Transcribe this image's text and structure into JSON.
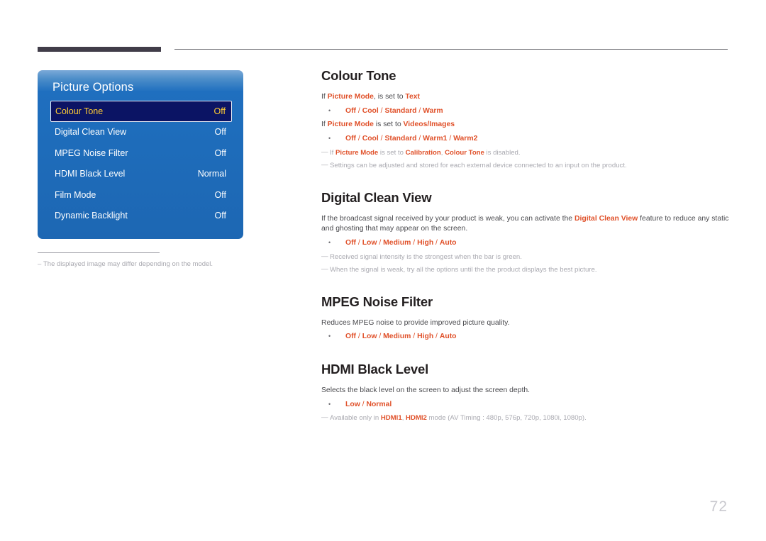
{
  "page": {
    "number": "72"
  },
  "osd": {
    "title": "Picture Options",
    "rows": [
      {
        "label": "Colour Tone",
        "value": "Off",
        "selected": true
      },
      {
        "label": "Digital Clean View",
        "value": "Off",
        "selected": false
      },
      {
        "label": "MPEG Noise Filter",
        "value": "Off",
        "selected": false
      },
      {
        "label": "HDMI Black Level",
        "value": "Normal",
        "selected": false
      },
      {
        "label": "Film Mode",
        "value": "Off",
        "selected": false
      },
      {
        "label": "Dynamic Backlight",
        "value": "Off",
        "selected": false
      }
    ],
    "figure_note": "The displayed image may differ depending on the model.",
    "figure_note_dash": "–",
    "colors": {
      "panel_top": "#7ba9d8",
      "panel_bottom": "#1d67b3",
      "selected_background": "#0b1464",
      "selected_text": "#ffcc33",
      "row_text": "#ffffff"
    }
  },
  "theme": {
    "accent": "#e0512a",
    "heading": "#231f20",
    "body": "#4b4b4f",
    "note": "#a9a9b0",
    "rule_thick": "#413d49",
    "rule_thin": "#6e6e73",
    "page_number": "#c9c9cf"
  },
  "sections": [
    {
      "id": "colour-tone",
      "title": "Colour Tone",
      "lines": [
        {
          "parts": [
            {
              "t": "If ",
              "a": false
            },
            {
              "t": "Picture Mode",
              "a": true
            },
            {
              "t": ", is set to ",
              "a": false
            },
            {
              "t": "Text",
              "a": true
            }
          ]
        }
      ],
      "options_1": {
        "bullet": "•",
        "items": [
          "Off",
          "Cool",
          "Standard",
          "Warm"
        ],
        "separator": "/"
      },
      "lines_2": [
        {
          "parts": [
            {
              "t": "If ",
              "a": false
            },
            {
              "t": "Picture Mode",
              "a": true
            },
            {
              "t": " is set to ",
              "a": false
            },
            {
              "t": "Videos/Images",
              "a": true
            }
          ]
        }
      ],
      "options_2": {
        "bullet": "•",
        "items": [
          "Off",
          "Cool",
          "Standard",
          "Warm1",
          "Warm2"
        ],
        "separator": "/"
      },
      "notes": [
        {
          "dash": "—",
          "parts": [
            {
              "t": "If ",
              "a": false
            },
            {
              "t": "Picture Mode",
              "a": true
            },
            {
              "t": " is set to ",
              "a": false
            },
            {
              "t": "Calibration",
              "a": true
            },
            {
              "t": ", ",
              "a": false
            },
            {
              "t": "Colour Tone",
              "a": true
            },
            {
              "t": " is disabled.",
              "a": false
            }
          ]
        },
        {
          "dash": "—",
          "parts": [
            {
              "t": "Settings can be adjusted and stored for each external device connected to an input on the product.",
              "a": false
            }
          ]
        }
      ]
    },
    {
      "id": "digital-clean-view",
      "title": "Digital Clean View",
      "lines": [
        {
          "parts": [
            {
              "t": "If the broadcast signal received by your product is weak, you can activate the ",
              "a": false
            },
            {
              "t": "Digital Clean View",
              "a": true
            },
            {
              "t": " feature to reduce any static and ghosting that may appear on the screen.",
              "a": false
            }
          ]
        }
      ],
      "options_1": {
        "bullet": "•",
        "items": [
          "Off",
          "Low",
          "Medium",
          "High",
          "Auto"
        ],
        "separator": "/"
      },
      "notes": [
        {
          "dash": "—",
          "parts": [
            {
              "t": "Received signal intensity is the strongest when the bar is green.",
              "a": false
            }
          ]
        },
        {
          "dash": "—",
          "parts": [
            {
              "t": "When the signal is weak, try all the options until the the product displays the best picture.",
              "a": false
            }
          ]
        }
      ]
    },
    {
      "id": "mpeg-noise-filter",
      "title": "MPEG Noise Filter",
      "lines": [
        {
          "parts": [
            {
              "t": "Reduces MPEG noise to provide improved picture quality.",
              "a": false
            }
          ]
        }
      ],
      "options_1": {
        "bullet": "•",
        "items": [
          "Off",
          "Low",
          "Medium",
          "High",
          "Auto"
        ],
        "separator": "/"
      },
      "notes": []
    },
    {
      "id": "hdmi-black-level",
      "title": "HDMI Black Level",
      "lines": [
        {
          "parts": [
            {
              "t": "Selects the black level on the screen to adjust the screen depth.",
              "a": false
            }
          ]
        }
      ],
      "options_1": {
        "bullet": "•",
        "items": [
          "Low",
          "Normal"
        ],
        "separator": "/"
      },
      "notes": [
        {
          "dash": "—",
          "parts": [
            {
              "t": "Available only in ",
              "a": false
            },
            {
              "t": "HDMI1",
              "a": true
            },
            {
              "t": ", ",
              "a": false
            },
            {
              "t": "HDMI2",
              "a": true
            },
            {
              "t": " mode (AV Timing : 480p, 576p, 720p, 1080i, 1080p).",
              "a": false
            }
          ]
        }
      ]
    }
  ]
}
